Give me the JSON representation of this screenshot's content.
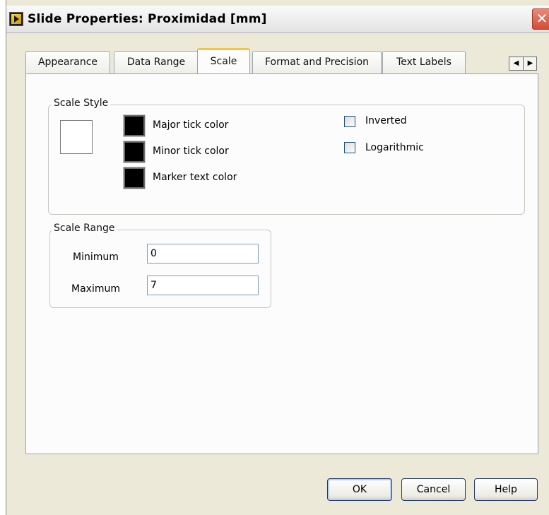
{
  "window": {
    "title": "Slide Properties: Proximidad [mm]",
    "close_label": "✕"
  },
  "tabs": [
    {
      "label": "Appearance",
      "active": false
    },
    {
      "label": "Data Range",
      "active": false
    },
    {
      "label": "Scale",
      "active": true
    },
    {
      "label": "Format and Precision",
      "active": false
    },
    {
      "label": "Text Labels",
      "active": false
    }
  ],
  "tab_scroll": {
    "left": "◀",
    "right": "▶"
  },
  "scale_style": {
    "legend": "Scale Style",
    "major_tick_label": "Major tick color",
    "minor_tick_label": "Minor tick color",
    "marker_text_label": "Marker text color",
    "colors": {
      "major_tick": "#000000",
      "minor_tick": "#000000",
      "marker_text": "#000000",
      "preview": "#ffffff"
    },
    "inverted_label": "Inverted",
    "inverted_checked": false,
    "logarithmic_label": "Logarithmic",
    "logarithmic_checked": false
  },
  "scale_range": {
    "legend": "Scale Range",
    "minimum_label": "Minimum",
    "minimum_value": "0",
    "maximum_label": "Maximum",
    "maximum_value": "7"
  },
  "buttons": {
    "ok": "OK",
    "cancel": "Cancel",
    "help": "Help"
  }
}
